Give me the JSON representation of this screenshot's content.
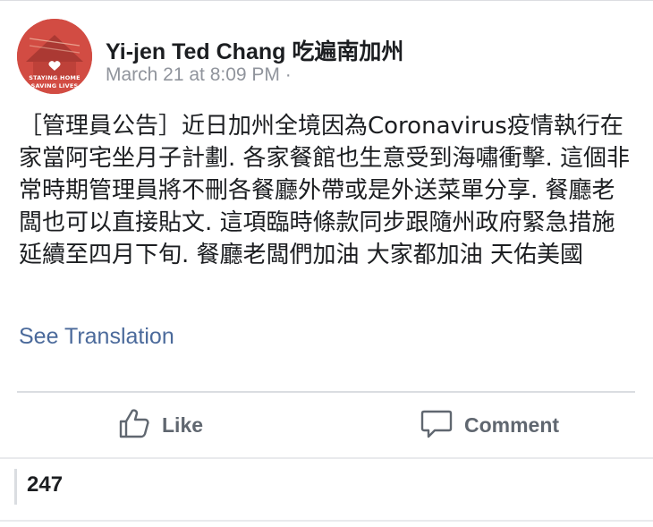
{
  "post": {
    "author": "Yi-jen Ted Chang 吃遍南加州",
    "timestamp": "March 21 at 8:09 PM ·",
    "avatar_text_line1": "STAYING HOME",
    "avatar_text_line2": "SAVING LIVES",
    "text": "［管理員公告］近日加州全境因為Coronavirus疫情執行在家當阿宅坐月子計劃. 各家餐館也生意受到海嘯衝擊. 這個非常時期管理員將不刪各餐廳外帶或是外送菜單分享. 餐廳老闆也可以直接貼文. 這項臨時條款同步跟隨州政府緊急措施延續至四月下旬. 餐廳老闆們加油 大家都加油 天佑美國",
    "see_translation": "See Translation"
  },
  "actions": {
    "like_label": "Like",
    "like_icon": "thumbs-up-icon",
    "comment_label": "Comment",
    "comment_icon": "speech-bubble-icon"
  },
  "reactions": {
    "count": "247"
  },
  "colors": {
    "text": "#1c1e21",
    "meta": "#90949c",
    "link": "#4b6a9b",
    "action": "#606770",
    "avatar_bg": "#d24c43"
  }
}
